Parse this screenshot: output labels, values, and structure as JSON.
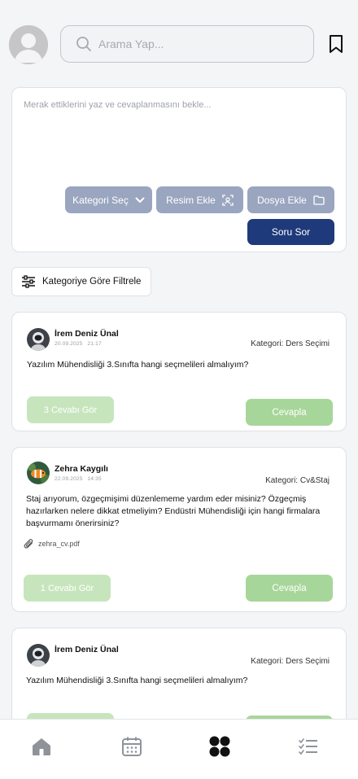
{
  "header": {
    "search_placeholder": "Arama Yap..."
  },
  "composer": {
    "placeholder": "Merak ettiklerini yaz ve cevaplanmasını bekle...",
    "category_button": "Kategori Seç",
    "image_button": "Resim Ekle",
    "file_button": "Dosya Ekle",
    "submit_button": "Soru Sor"
  },
  "filter": {
    "label": "Kategoriye Göre Filtrele"
  },
  "posts": [
    {
      "author": "İrem Deniz Ünal",
      "date": "20.09.2025",
      "time": "21:17",
      "category": "Kategori: Ders Seçimi",
      "question": "Yazılım Mühendisliği 3.Sınıfta hangi seçmelileri almalıyım?",
      "answers_button": "3  Cevabı Gör",
      "reply_button": "Cevapla"
    },
    {
      "author": "Zehra Kaygılı",
      "date": "22.09.2025",
      "time": "14:35",
      "category": "Kategori: Cv&Staj",
      "question": "Staj arıyorum, özgeçmişimi düzenlememe yardım eder misiniz? Özgeçmiş hazırlarken nelere dikkat etmeliyim? Endüstri Mühendisliği için hangi firmalara başvurmamı önerirsiniz?",
      "attachment": "zehra_cv.pdf",
      "answers_button": "1  Cevabı Gör",
      "reply_button": "Cevapla"
    },
    {
      "author": "İrem Deniz Ünal",
      "category": "Kategori: Ders Seçimi",
      "question": "Yazılım Mühendisliği 3.Sınıfta hangi seçmelileri almalıyım?"
    }
  ],
  "nav": {
    "items": [
      "home-icon",
      "calendar-icon",
      "grid-icon",
      "checklist-icon"
    ],
    "active": "grid-icon"
  },
  "colors": {
    "primary": "#1f3a7a",
    "chip": "#9aa6bf",
    "green": "#a7d69a",
    "green_light": "#c7e5bd",
    "background": "#f4f5f7"
  }
}
